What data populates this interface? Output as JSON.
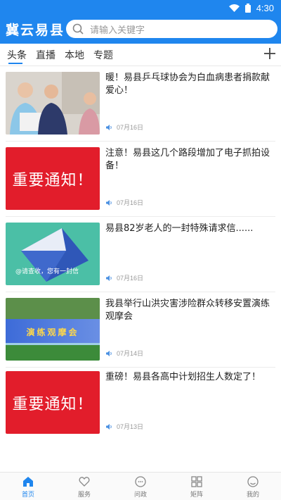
{
  "status_bar": {
    "time": "4:30",
    "wifi_icon": "wifi-icon",
    "battery_icon": "battery-icon"
  },
  "header": {
    "app_title": "冀云易县",
    "search_placeholder": "请输入关键字",
    "search_icon": "search-icon"
  },
  "tabs": [
    {
      "label": "头条",
      "active": true
    },
    {
      "label": "直播",
      "active": false
    },
    {
      "label": "本地",
      "active": false
    },
    {
      "label": "专题",
      "active": false
    }
  ],
  "add_icon": "plus-icon",
  "news": [
    {
      "title": "暖！易县乒乓球协会为白血病患者捐款献爱心！",
      "date": "07月16日",
      "thumb": "photo"
    },
    {
      "title": "注意！易县这几个路段增加了电子抓拍设备！",
      "date": "07月16日",
      "thumb": "notice",
      "thumb_text": "重要通知！"
    },
    {
      "title": "易县82岁老人的一封特殊请求信......",
      "date": "07月16日",
      "thumb": "mail",
      "thumb_text": "@请查收，您有一封信"
    },
    {
      "title": "我县举行山洪灾害涉险群众转移安置演练观摩会",
      "date": "07月14日",
      "thumb": "banner",
      "thumb_text": "演练观摩会"
    },
    {
      "title": "重磅！易县各高中计划招生人数定了！",
      "date": "07月13日",
      "thumb": "notice",
      "thumb_text": "重要通知！"
    }
  ],
  "bottom_nav": [
    {
      "label": "首页",
      "icon": "home-icon",
      "active": true
    },
    {
      "label": "服务",
      "icon": "heart-icon",
      "active": false
    },
    {
      "label": "问政",
      "icon": "chat-icon",
      "active": false
    },
    {
      "label": "矩阵",
      "icon": "grid-icon",
      "active": false
    },
    {
      "label": "我的",
      "icon": "user-icon",
      "active": false
    }
  ],
  "colors": {
    "brand": "#1f86ee",
    "notice_red": "#e21d2b",
    "mail_green": "#4bbfa6"
  }
}
